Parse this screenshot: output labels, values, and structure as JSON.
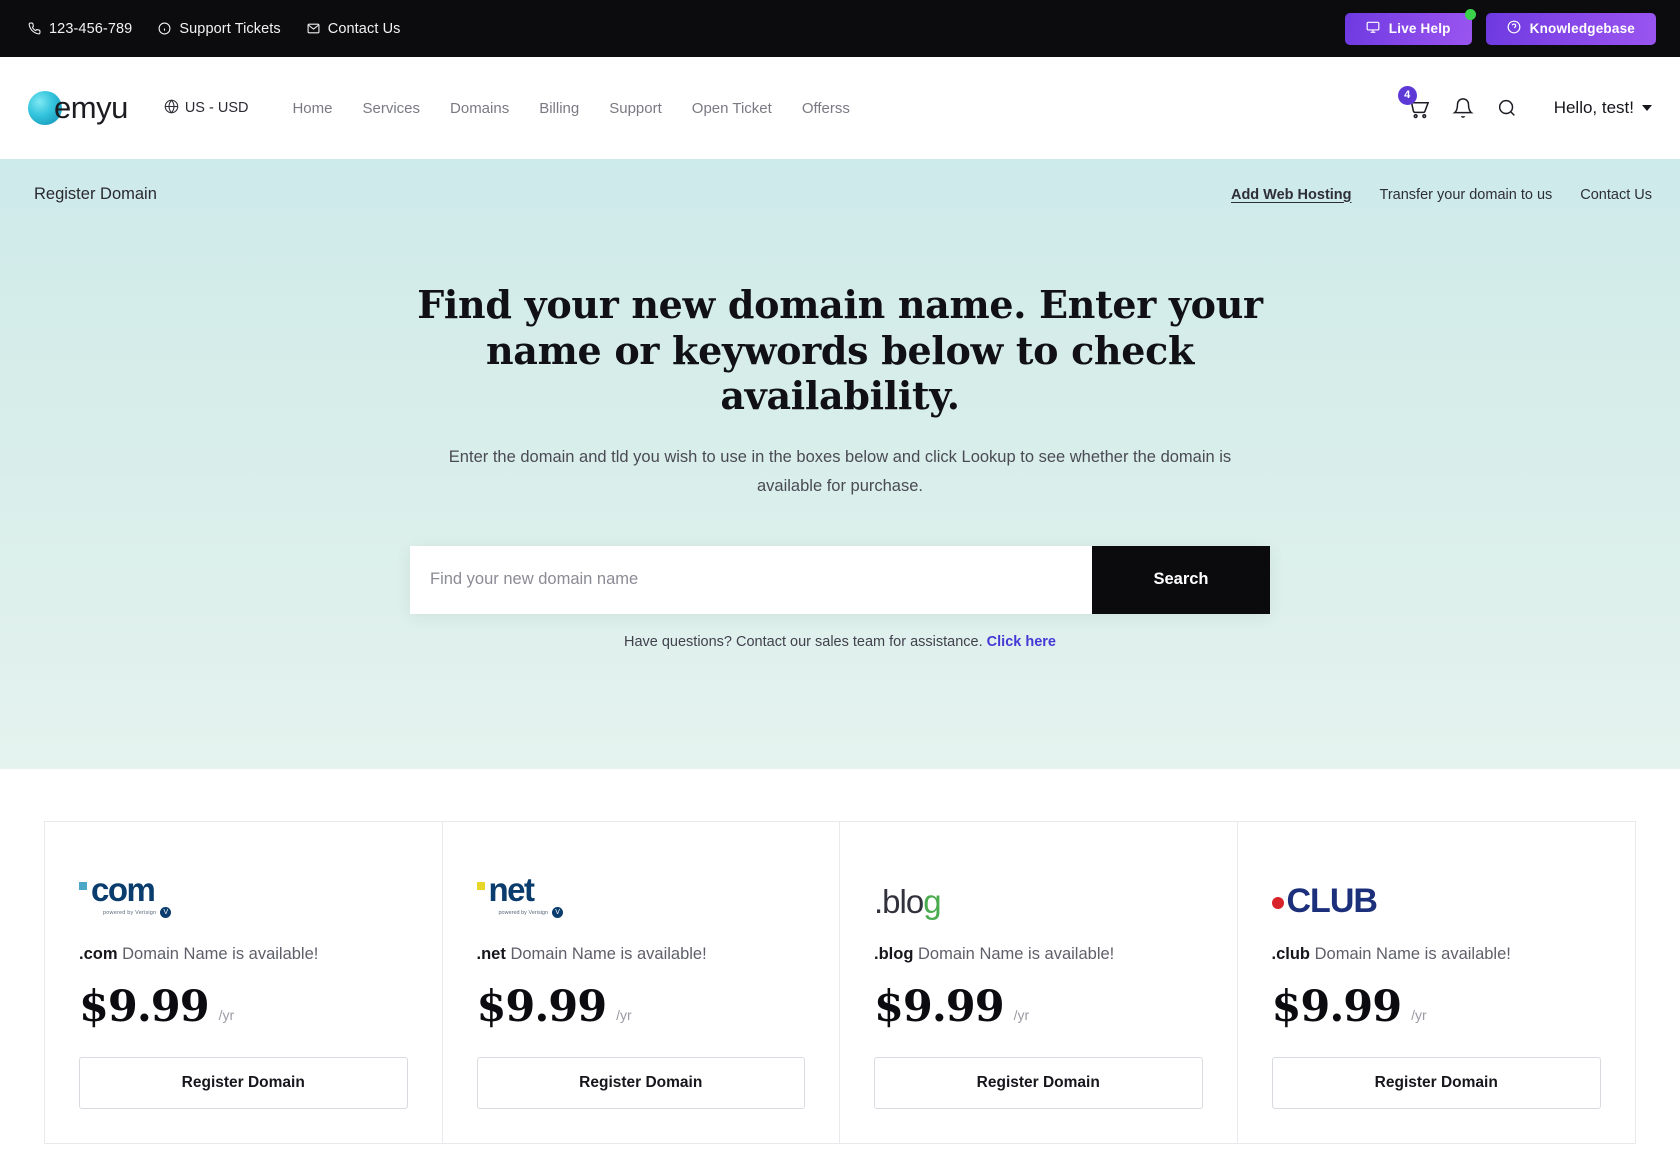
{
  "topbar": {
    "phone": "123-456-789",
    "support_tickets": "Support Tickets",
    "contact_us": "Contact Us",
    "live_help": "Live Help",
    "knowledgebase": "Knowledgebase",
    "live_help_badge_color": "#3ad24a",
    "button_gradient_from": "#6d3ae0",
    "button_gradient_to": "#9a55ef"
  },
  "nav": {
    "logo_text": "emyu",
    "currency": "US - USD",
    "menu": [
      {
        "label": "Home"
      },
      {
        "label": "Services"
      },
      {
        "label": "Domains"
      },
      {
        "label": "Billing"
      },
      {
        "label": "Support"
      },
      {
        "label": "Open Ticket"
      },
      {
        "label": "Offerss"
      }
    ],
    "cart_count": "4",
    "cart_badge_color": "#5d3ad6",
    "user_greeting": "Hello, test!"
  },
  "subnav": {
    "breadcrumb": "Register Domain",
    "links": [
      {
        "label": "Add Web Hosting",
        "active": true
      },
      {
        "label": "Transfer your domain to us",
        "active": false
      },
      {
        "label": "Contact Us",
        "active": false
      }
    ]
  },
  "hero": {
    "title": "Find your new domain name. Enter your name or keywords below to check availability.",
    "subtitle": "Enter the domain and tld you wish to use in the boxes below and click Lookup to see whether the domain is available for purchase.",
    "search_placeholder": "Find your new domain name",
    "search_value": "",
    "search_button": "Search",
    "note_text": "Have questions? Contact our sales team for assistance.",
    "note_link": "Click here",
    "note_link_color": "#4438d6",
    "background_color": "#d4ecea"
  },
  "cards": [
    {
      "tld": ".com",
      "logo_style": "com",
      "logo_word": "com",
      "logo_sub": "powered by Verisign",
      "logo_color": "#0a3d6e",
      "accent_color": "#4aa7c8",
      "availability_prefix": ".com",
      "availability_text": "Domain Name is available!",
      "price": "$9.99",
      "period": "/yr",
      "button": "Register Domain"
    },
    {
      "tld": ".net",
      "logo_style": "net",
      "logo_word": "net",
      "logo_sub": "powered by Verisign",
      "logo_color": "#0a3d6e",
      "accent_color": "#e8d628",
      "availability_prefix": ".net",
      "availability_text": "Domain Name is available!",
      "price": "$9.99",
      "period": "/yr",
      "button": "Register Domain"
    },
    {
      "tld": ".blog",
      "logo_style": "blog",
      "logo_word": ".blog",
      "logo_sub": "",
      "logo_color": "#32323c",
      "accent_color": "#4aab4f",
      "availability_prefix": ".blog",
      "availability_text": "Domain Name is available!",
      "price": "$9.99",
      "period": "/yr",
      "button": "Register Domain"
    },
    {
      "tld": ".club",
      "logo_style": "club",
      "logo_word": "CLUB",
      "logo_sub": "",
      "logo_color": "#1c2f7a",
      "accent_color": "#d8232a",
      "availability_prefix": ".club",
      "availability_text": "Domain Name is available!",
      "price": "$9.99",
      "period": "/yr",
      "button": "Register Domain"
    }
  ]
}
